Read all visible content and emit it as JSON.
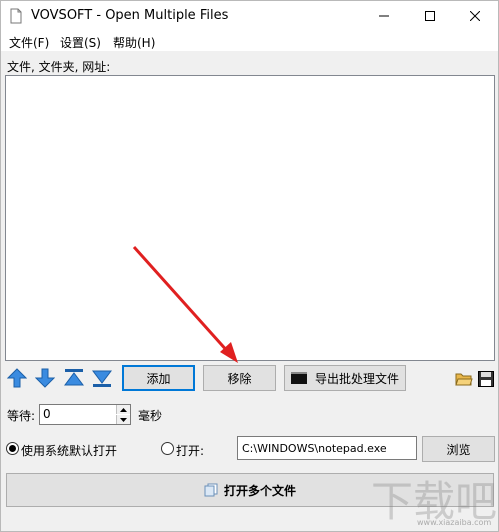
{
  "window": {
    "title": "VOVSOFT - Open Multiple Files"
  },
  "menu": {
    "file": "文件(F)",
    "settings": "设置(S)",
    "help": "帮助(H)"
  },
  "files_label": "文件, 文件夹, 网址:",
  "toolbar": {
    "add": "添加",
    "remove": "移除",
    "export": "导出批处理文件"
  },
  "wait": {
    "label": "等待:",
    "value": "0",
    "unit": "毫秒"
  },
  "open_mode": {
    "default_label": "使用系统默认打开",
    "open_with_label": "打开:",
    "selected": "default",
    "path_value": "C:\\WINDOWS\\notepad.exe",
    "browse": "浏览"
  },
  "open_button": "打开多个文件",
  "watermark": {
    "text": "下载吧",
    "sub": "www.xiazaiba.com"
  },
  "colors": {
    "accent": "#0078d7",
    "arrow": "#e02020"
  }
}
